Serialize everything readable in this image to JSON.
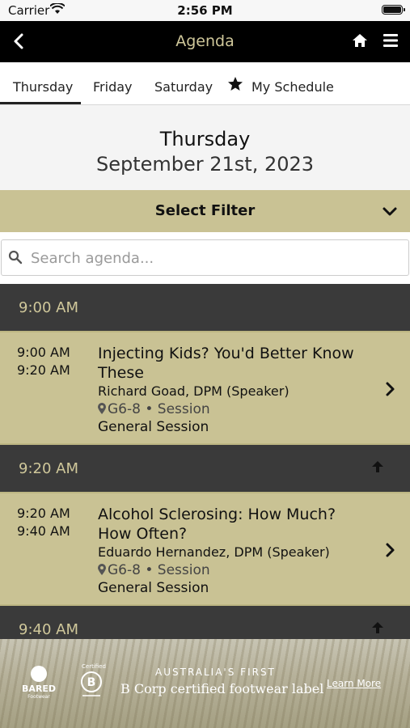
{
  "status_bar": {
    "carrier": "Carrier",
    "time": "2:56 PM"
  },
  "nav": {
    "title": "Agenda"
  },
  "tabs": [
    {
      "label": "Thursday",
      "active": true
    },
    {
      "label": "Friday",
      "active": false
    },
    {
      "label": "Saturday",
      "active": false
    },
    {
      "label": "My Schedule",
      "active": false
    }
  ],
  "day_header": {
    "weekday": "Thursday",
    "date": "September 21st, 2023"
  },
  "filter": {
    "label": "Select Filter"
  },
  "search": {
    "placeholder": "Search agenda..."
  },
  "time_slots": [
    {
      "label": "9:00 AM"
    },
    {
      "label": "9:20 AM"
    },
    {
      "label": "9:40 AM"
    }
  ],
  "sessions": [
    {
      "start": "9:00 AM",
      "end": "9:20 AM",
      "title": "Injecting Kids? You'd Better Know These",
      "speaker": "Richard Goad, DPM (Speaker)",
      "location": "G6-8 • Session",
      "track": "General Session"
    },
    {
      "start": "9:20 AM",
      "end": "9:40 AM",
      "title": "Alcohol Sclerosing: How Much? How Often?",
      "speaker": "Eduardo Hernandez, DPM (Speaker)",
      "location": "G6-8 • Session",
      "track": "General Session"
    }
  ],
  "ad": {
    "brand": "BARED",
    "brand_sub": "Footwear",
    "cert": "Certified",
    "line1": "AUSTRALIA'S FIRST",
    "line2": "B Corp certified footwear label",
    "cta": "Learn More"
  },
  "colors": {
    "accent": "#c9c294",
    "header_bg": "#000000",
    "slot_bg": "#3a3a3a",
    "title_gold": "#cfc79a"
  },
  "icons": [
    "wifi-icon",
    "battery-icon",
    "back-chevron-icon",
    "home-icon",
    "hamburger-menu-icon",
    "star-icon",
    "chevron-down-icon",
    "search-icon",
    "arrow-up-icon",
    "chevron-right-icon",
    "location-pin-icon"
  ]
}
